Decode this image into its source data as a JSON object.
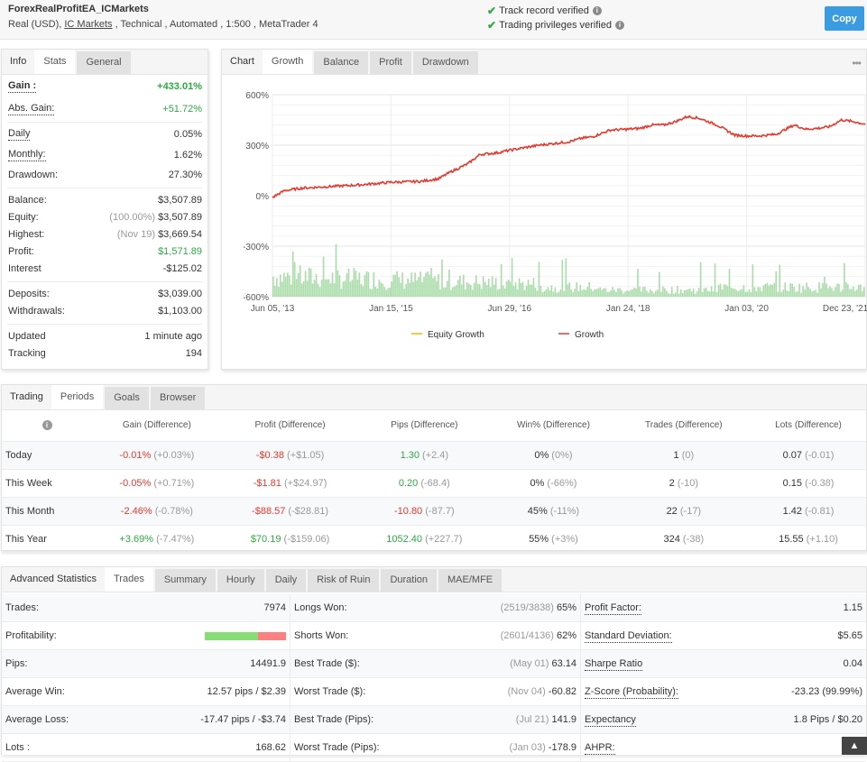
{
  "header": {
    "title": "ForexRealProfitEA_ICMarkets",
    "sub_prefix": "Real (USD),",
    "broker_link": "IC Markets",
    "sub_suffix": ", Technical , Automated , 1:500 , MetaTrader 4",
    "verified": [
      "Track record verified",
      "Trading privileges verified"
    ],
    "copy_label": "Copy"
  },
  "info": {
    "tabs": {
      "title": "Info",
      "items": [
        "Stats",
        "General"
      ],
      "active": "Stats"
    },
    "gain": {
      "label": "Gain :",
      "value": "+433.01%"
    },
    "abs_gain": {
      "label": "Abs. Gain:",
      "value": "+51.72%"
    },
    "daily": {
      "label": "Daily",
      "value": "0.05%"
    },
    "monthly": {
      "label": "Monthly:",
      "value": "1.62%"
    },
    "drawdown": {
      "label": "Drawdown:",
      "value": "27.30%"
    },
    "balance": {
      "label": "Balance:",
      "value": "$3,507.89"
    },
    "equity": {
      "label": "Equity:",
      "note": "(100.00%)",
      "value": "$3,507.89"
    },
    "highest": {
      "label": "Highest:",
      "note": "(Nov 19)",
      "value": "$3,669.54"
    },
    "profit": {
      "label": "Profit:",
      "value": "$1,571.89"
    },
    "interest": {
      "label": "Interest",
      "value": "-$125.02"
    },
    "deposits": {
      "label": "Deposits:",
      "value": "$3,039.00"
    },
    "withdrawals": {
      "label": "Withdrawals:",
      "value": "$1,103.00"
    },
    "updated": {
      "label": "Updated",
      "value": "1 minute ago"
    },
    "tracking": {
      "label": "Tracking",
      "value": "194"
    }
  },
  "chart": {
    "tabs": {
      "title": "Chart",
      "items": [
        "Growth",
        "Balance",
        "Profit",
        "Drawdown"
      ],
      "active": "Growth"
    },
    "more_icon": "•••"
  },
  "chart_data": {
    "type": "line",
    "title": "Growth",
    "xlabel": "",
    "ylabel": "",
    "x_ticks": [
      "Jun 05, '13",
      "Jan 15, '15",
      "Jun 29, '16",
      "Jan 24, '18",
      "Jan 03, '20",
      "Dec 23, '21"
    ],
    "y_ticks": [
      "600%",
      "300%",
      "0%",
      "-300%",
      "-600%"
    ],
    "ylim": [
      -600,
      600
    ],
    "grid": true,
    "legend": {
      "position": "bottom",
      "entries": [
        "Equity Growth",
        "Growth"
      ]
    },
    "series": [
      {
        "name": "Growth",
        "color": "#e8392f",
        "x_fraction": [
          0,
          0.02,
          0.05,
          0.1,
          0.15,
          0.2,
          0.25,
          0.28,
          0.3,
          0.33,
          0.35,
          0.38,
          0.4,
          0.45,
          0.5,
          0.52,
          0.54,
          0.57,
          0.6,
          0.62,
          0.64,
          0.66,
          0.68,
          0.7,
          0.72,
          0.75,
          0.78,
          0.8,
          0.82,
          0.85,
          0.88,
          0.9,
          0.92,
          0.94,
          0.96,
          0.98,
          1.0
        ],
        "values": [
          -10,
          30,
          45,
          55,
          65,
          80,
          85,
          100,
          140,
          190,
          245,
          255,
          270,
          300,
          320,
          340,
          350,
          390,
          395,
          400,
          420,
          420,
          440,
          470,
          460,
          420,
          360,
          355,
          355,
          365,
          420,
          395,
          400,
          410,
          450,
          440,
          425
        ]
      },
      {
        "name": "Equity Growth",
        "color": "#f5b800",
        "same_as": "Growth"
      }
    ],
    "volume_bars": {
      "color": "#9bd69b",
      "description": "daily trade volume bars along bottom"
    }
  },
  "periods": {
    "tabs": {
      "title": "Trading",
      "items": [
        "Periods",
        "Goals",
        "Browser"
      ],
      "active": "Periods"
    },
    "columns": [
      "Gain (Difference)",
      "Profit (Difference)",
      "Pips (Difference)",
      "Win% (Difference)",
      "Trades (Difference)",
      "Lots (Difference)"
    ],
    "rows": [
      {
        "label": "Today",
        "gain": "-0.01%",
        "gain_d": "(+0.03%)",
        "profit": "-$0.38",
        "profit_d": "(+$1.05)",
        "pips": "1.30",
        "pips_d": "(+2.4)",
        "win": "0%",
        "win_d": "(0%)",
        "trades": "1",
        "trades_d": "(0)",
        "lots": "0.07",
        "lots_d": "(-0.01)"
      },
      {
        "label": "This Week",
        "gain": "-0.05%",
        "gain_d": "(+0.71%)",
        "profit": "-$1.81",
        "profit_d": "(+$24.97)",
        "pips": "0.20",
        "pips_d": "(-68.4)",
        "win": "0%",
        "win_d": "(-66%)",
        "trades": "2",
        "trades_d": "(-10)",
        "lots": "0.15",
        "lots_d": "(-0.38)"
      },
      {
        "label": "This Month",
        "gain": "-2.46%",
        "gain_d": "(-0.78%)",
        "profit": "-$88.57",
        "profit_d": "(-$28.81)",
        "pips": "-10.80",
        "pips_d": "(-87.7)",
        "win": "45%",
        "win_d": "(-11%)",
        "trades": "22",
        "trades_d": "(-17)",
        "lots": "1.42",
        "lots_d": "(-0.81)"
      },
      {
        "label": "This Year",
        "gain": "+3.69%",
        "gain_d": "(-7.47%)",
        "profit": "$70.19",
        "profit_d": "(-$159.06)",
        "pips": "1052.40",
        "pips_d": "(+227.7)",
        "win": "55%",
        "win_d": "(+3%)",
        "trades": "324",
        "trades_d": "(-38)",
        "lots": "15.55",
        "lots_d": "(+1.10)"
      }
    ]
  },
  "advanced": {
    "tabs": {
      "title": "Advanced Statistics",
      "items": [
        "Trades",
        "Summary",
        "Hourly",
        "Daily",
        "Risk of Ruin",
        "Duration",
        "MAE/MFE"
      ],
      "active": "Trades"
    },
    "col1": [
      {
        "label": "Trades:",
        "value": "7974"
      },
      {
        "label": "Profitability:",
        "win_fraction": 0.65
      },
      {
        "label": "Pips:",
        "value": "14491.9"
      },
      {
        "label": "Average Win:",
        "value": "12.57 pips / $2.39"
      },
      {
        "label": "Average Loss:",
        "value": "-17.47 pips / -$3.74"
      },
      {
        "label": "Lots :",
        "value": "168.62"
      }
    ],
    "col2": [
      {
        "label": "Longs Won:",
        "note": "(2519/3838)",
        "value": "65%"
      },
      {
        "label": "Shorts Won:",
        "note": "(2601/4136)",
        "value": "62%"
      },
      {
        "label": "Best Trade ($):",
        "note": "(May 01)",
        "value": "63.14"
      },
      {
        "label": "Worst Trade ($):",
        "note": "(Nov 04)",
        "value": "-60.82"
      },
      {
        "label": "Best Trade (Pips):",
        "note": "(Jul 21)",
        "value": "141.9"
      },
      {
        "label": "Worst Trade (Pips):",
        "note": "(Jan 03)",
        "value": "-178.9"
      }
    ],
    "col3": [
      {
        "label": "Profit Factor:",
        "value": "1.15"
      },
      {
        "label": "Standard Deviation:",
        "value": "$5.65"
      },
      {
        "label": "Sharpe Ratio",
        "value": "0.04"
      },
      {
        "label": "Z-Score (Probability):",
        "value": "-23.23 (99.99%)"
      },
      {
        "label": "Expectancy",
        "value": "1.8 Pips / $0.20"
      },
      {
        "label": "AHPR:",
        "value": ""
      }
    ]
  },
  "scroll_top_icon": "▲"
}
